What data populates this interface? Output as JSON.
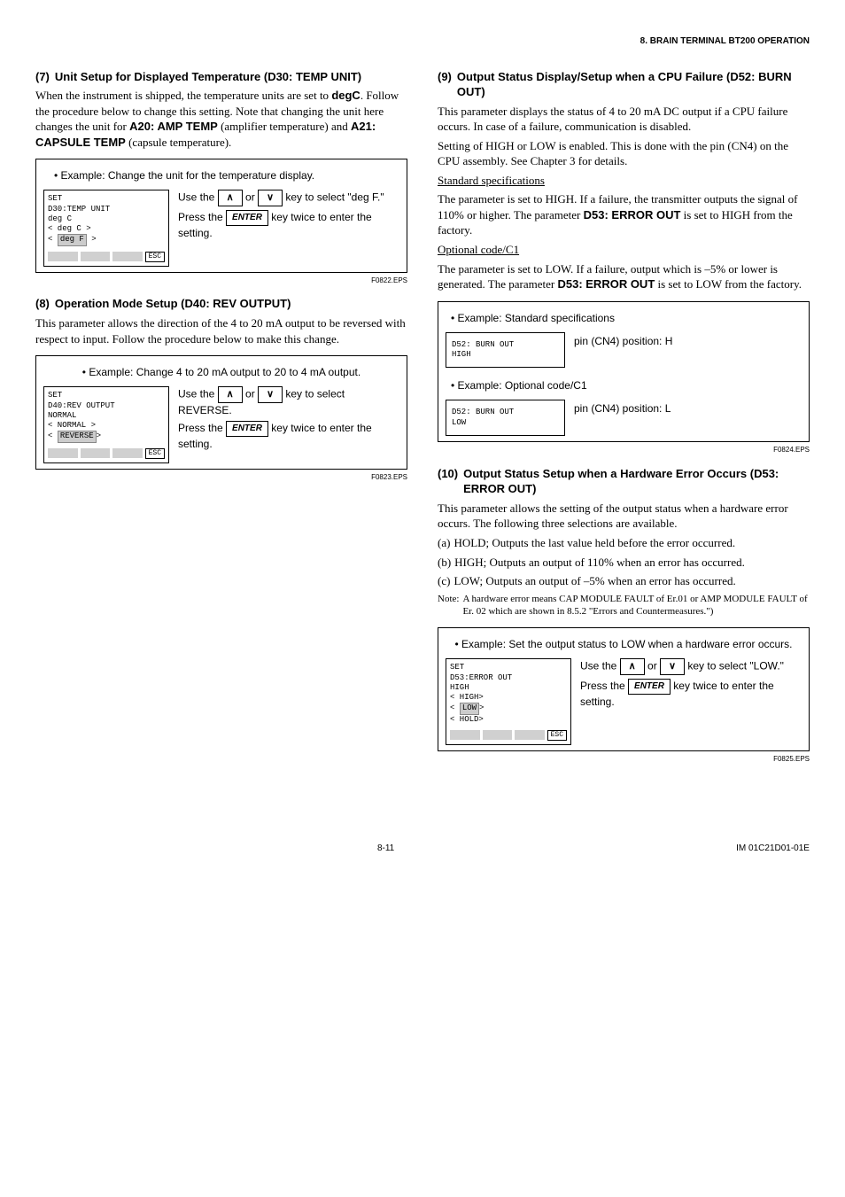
{
  "page_header": "8.   BRAIN TERMINAL BT200 OPERATION",
  "left": {
    "section7": {
      "num": "(7)",
      "title": "Unit Setup for Displayed Temperature (D30: TEMP UNIT)",
      "para": "When the instrument is shipped, the temperature units are set to ",
      "para_bold1": "degC",
      "para_mid": ".   Follow the procedure below to change this setting. Note that changing the unit here changes the unit for ",
      "para_bold2": "A20: AMP TEMP",
      "para_after2": " (amplifier temperature) and ",
      "para_bold3": "A21: CAPSULE TEMP",
      "para_after3": " (capsule temperature).",
      "example_title": "• Example: Change the unit for the temperature display.",
      "lcd_l1": "SET",
      "lcd_l2": " D30:TEMP UNIT",
      "lcd_l3": "    deg C",
      "lcd_l4": "  < deg C >",
      "lcd_l5_a": "  < ",
      "lcd_l5_b": "deg F",
      "lcd_l5_c": " >",
      "lcd_esc": "ESC",
      "inst_l1a": "Use the ",
      "inst_l1b": " or ",
      "inst_l1c": " key to select \"deg F.\"",
      "inst_l2a": "Press the ",
      "inst_l2b": " key twice to enter the setting.",
      "arrow_up": "∧",
      "arrow_down": "∨",
      "enter_label": "ENTER",
      "caption": "F0822.EPS"
    },
    "section8": {
      "num": "(8)",
      "title": "Operation Mode Setup (D40: REV OUTPUT)",
      "para": "This parameter allows the direction of the 4 to 20 mA output to be reversed with respect to input. Follow the procedure below to make this change.",
      "example_title": "• Example: Change 4 to 20 mA output to 20 to 4 mA output.",
      "lcd_l1": "SET",
      "lcd_l2": " D40:REV OUTPUT",
      "lcd_l3": "     NORMAL",
      "lcd_l4": "   < NORMAL >",
      "lcd_l5_a": "   < ",
      "lcd_l5_b": "REVERSE",
      "lcd_l5_c": ">",
      "lcd_esc": "ESC",
      "inst_l1a": "Use the ",
      "inst_l1b": " or ",
      "inst_l1c": " key to select REVERSE.",
      "inst_l2a": "Press the ",
      "inst_l2b": " key twice to enter the setting.",
      "arrow_up": "∧",
      "arrow_down": "∨",
      "enter_label": "ENTER",
      "caption": "F0823.EPS"
    }
  },
  "right": {
    "section9": {
      "num": "(9)",
      "title": "Output Status Display/Setup when a CPU Failure (D52: BURN OUT)",
      "p1": "This parameter displays the status of 4 to 20 mA DC output if a CPU failure occurs. In case of a failure, communication is disabled.",
      "p2": "Setting of HIGH or LOW is enabled. This is done with the pin (CN4) on the CPU assembly. See Chapter 3 for details.",
      "std_h": "Standard specifications",
      "std_p_a": "The parameter is set to HIGH. If a failure, the transmitter outputs the signal of 110% or higher. The parameter ",
      "std_p_b": "D53: ERROR OUT",
      "std_p_c": " is set to HIGH from the factory.",
      "opt_h": "Optional code/C1",
      "opt_p_a": "The parameter is set to LOW. If a failure, output which is –5% or lower is generated. The parameter ",
      "opt_p_b": "D53: ERROR OUT",
      "opt_p_c": " is set to LOW from the factory.",
      "ex1_title": "• Example: Standard specifications",
      "ex1_lcd_l1": "D52: BURN   OUT",
      "ex1_lcd_l2": "     HIGH",
      "ex1_right": "pin (CN4) position: H",
      "ex2_title": "• Example: Optional code/C1",
      "ex2_lcd_l1": "D52: BURN   OUT",
      "ex2_lcd_l2": "     LOW",
      "ex2_right": "pin (CN4) position: L",
      "caption": "F0824.EPS"
    },
    "section10": {
      "num": "(10)",
      "title": "Output Status Setup when a Hardware Error Occurs (D53: ERROR OUT)",
      "p1": "This parameter allows the setting of the output status when a hardware error occurs. The following three selections are available.",
      "la_m": "(a)",
      "la": "HOLD; Outputs the last value held before the error occurred.",
      "lb_m": "(b)",
      "lb": "HIGH; Outputs an output of 110% when an error has occurred.",
      "lc_m": "(c)",
      "lc": "LOW; Outputs an output of –5% when an error has occurred.",
      "note_m": "Note:",
      "note": "A hardware error means CAP MODULE FAULT of Er.01 or AMP MODULE FAULT of Er. 02 which are shown in 8.5.2 \"Errors and Countermeasures.\")",
      "example_title": "• Example: Set the output status to LOW when a hardware error occurs.",
      "lcd_l1": "SET",
      "lcd_l2": " D53:ERROR OUT",
      "lcd_l3": "        HIGH",
      "lcd_l4": "  <     HIGH>",
      "lcd_l5_a": "  <     ",
      "lcd_l5_b": "LOW",
      "lcd_l5_c": ">",
      "lcd_l6": "  <     HOLD>",
      "lcd_esc": "ESC",
      "inst_l1a": "Use the ",
      "inst_l1b": " or ",
      "inst_l1c": " key to select \"LOW.\"",
      "inst_l2a": "Press the ",
      "inst_l2b": " key twice to enter the setting.",
      "arrow_up": "∧",
      "arrow_down": "∨",
      "enter_label": "ENTER",
      "caption": "F0825.EPS"
    }
  },
  "footer": {
    "page": "8-11",
    "doc": "IM 01C21D01-01E"
  }
}
